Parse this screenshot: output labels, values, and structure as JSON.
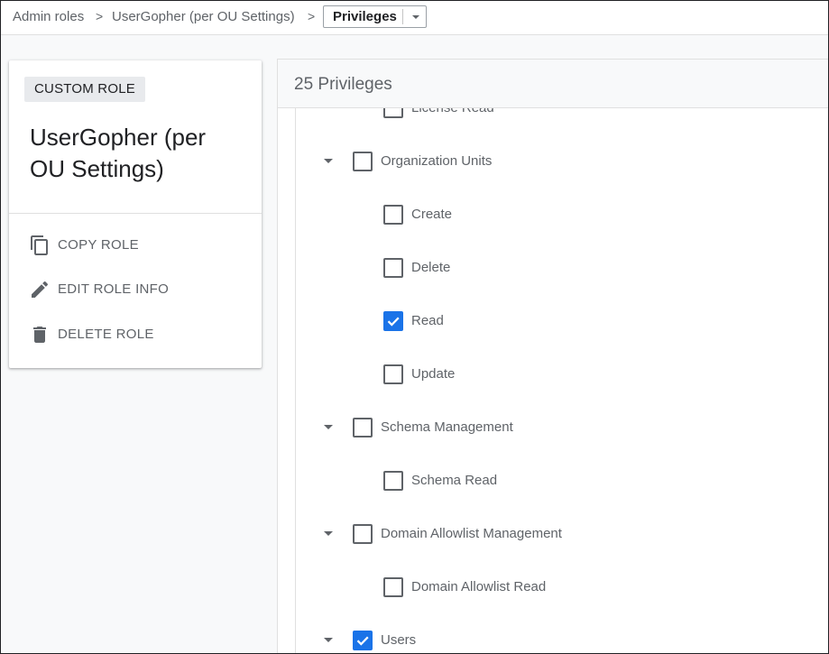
{
  "breadcrumb": {
    "items": [
      "Admin roles",
      "UserGopher (per OU Settings)"
    ],
    "separator": ">",
    "current": "Privileges"
  },
  "role": {
    "badge": "CUSTOM ROLE",
    "title": "UserGopher (per OU Settings)",
    "actions": [
      {
        "label": "COPY ROLE",
        "icon": "copy-icon"
      },
      {
        "label": "EDIT ROLE INFO",
        "icon": "pencil-icon"
      },
      {
        "label": "DELETE ROLE",
        "icon": "trash-icon"
      }
    ]
  },
  "privileges": {
    "count_label": "25 Privileges",
    "rows": [
      {
        "label": "License Read",
        "level": 1,
        "checked": false,
        "expandable": false
      },
      {
        "label": "Organization Units",
        "level": 0,
        "checked": false,
        "expandable": true
      },
      {
        "label": "Create",
        "level": 1,
        "checked": false,
        "expandable": false
      },
      {
        "label": "Delete",
        "level": 1,
        "checked": false,
        "expandable": false
      },
      {
        "label": "Read",
        "level": 1,
        "checked": true,
        "expandable": false
      },
      {
        "label": "Update",
        "level": 1,
        "checked": false,
        "expandable": false
      },
      {
        "label": "Schema Management",
        "level": 0,
        "checked": false,
        "expandable": true
      },
      {
        "label": "Schema Read",
        "level": 1,
        "checked": false,
        "expandable": false
      },
      {
        "label": "Domain Allowlist Management",
        "level": 0,
        "checked": false,
        "expandable": true
      },
      {
        "label": "Domain Allowlist Read",
        "level": 1,
        "checked": false,
        "expandable": false
      },
      {
        "label": "Users",
        "level": 0,
        "checked": true,
        "expandable": true
      }
    ]
  },
  "colors": {
    "accent": "#1a73e8",
    "text": "#5f6368",
    "title": "#202124"
  }
}
